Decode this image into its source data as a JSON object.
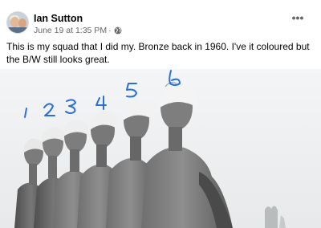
{
  "post": {
    "author": "Ian Sutton",
    "timestamp": "June 19 at 1:35 PM",
    "separator": "·",
    "privacy_icon": "globe-icon",
    "more_icon": "more-options-icon",
    "more_symbol": "•••",
    "caption": "This is my squad that I did my. Bronze  back in 1960. I've it coloured but the B/W still looks great.",
    "photo": {
      "annotations": [
        "1",
        "2",
        "3",
        "4",
        "5",
        "6"
      ],
      "annotation_color": "#2a6fd6"
    }
  }
}
